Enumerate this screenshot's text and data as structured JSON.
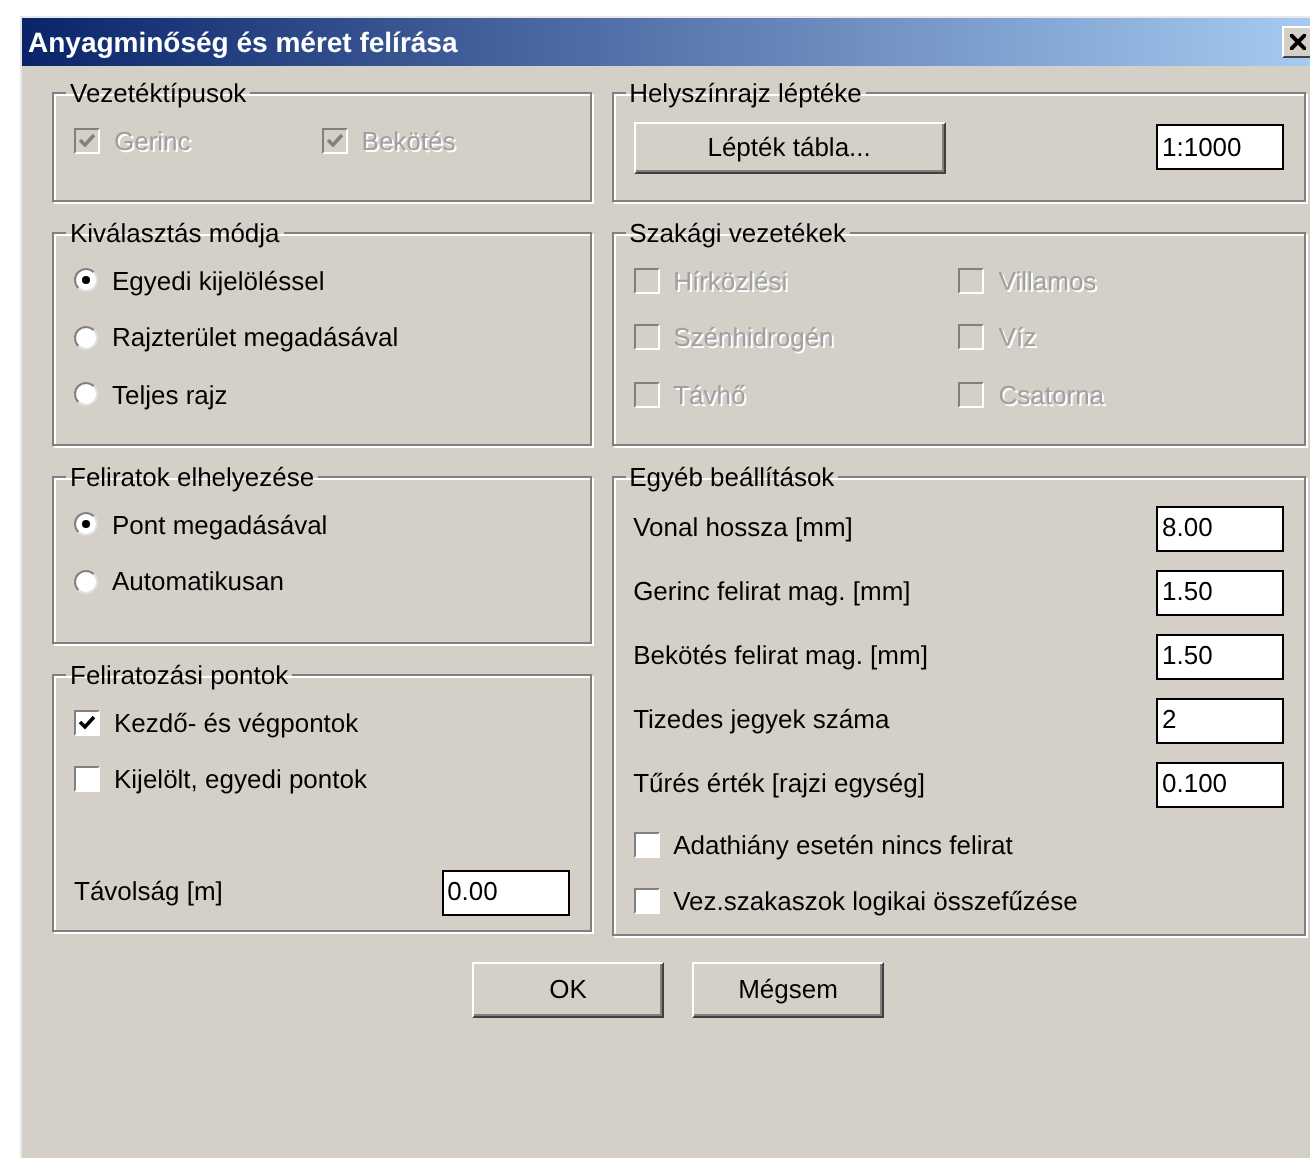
{
  "window": {
    "title": "Anyagminőség és méret felírása"
  },
  "left_column": [
    {
      "title": "Vezetéktípusok",
      "rows": [
        [
          {
            "kind": "checkbox",
            "label": "Gerinc",
            "checked": true,
            "disabled": true
          },
          {
            "kind": "checkbox",
            "label": "Bekötés",
            "checked": true,
            "disabled": true
          }
        ]
      ]
    },
    {
      "title": "Kiválasztás módja",
      "rows": [
        [
          {
            "kind": "radio",
            "label": "Egyedi kijelöléssel",
            "selected": true
          }
        ],
        [
          {
            "kind": "radio",
            "label": "Rajzterület megadásával",
            "selected": false
          }
        ],
        [
          {
            "kind": "radio",
            "label": "Teljes rajz",
            "selected": false
          }
        ]
      ]
    },
    {
      "title": "Feliratok elhelyezése",
      "rows": [
        [
          {
            "kind": "radio",
            "label": "Pont megadásával",
            "selected": true
          }
        ],
        [
          {
            "kind": "radio",
            "label": "Automatikusan",
            "selected": false
          }
        ]
      ]
    },
    {
      "title": "Feliratozási pontok",
      "rows": [
        [
          {
            "kind": "checkbox",
            "label": "Kezdő- és végpontok",
            "checked": true,
            "disabled": false
          }
        ],
        [
          {
            "kind": "checkbox",
            "label": "Kijelölt, egyedi pontok",
            "checked": false,
            "disabled": false
          }
        ],
        [
          {
            "kind": "field",
            "label": "Távolság [m]",
            "value": "0.00"
          }
        ]
      ]
    }
  ],
  "right_column": [
    {
      "title": "Helyszínrajz léptéke",
      "rows": [
        [
          {
            "kind": "button",
            "label": "Lépték tábla..."
          },
          {
            "kind": "field",
            "value": "1:1000"
          }
        ]
      ]
    },
    {
      "title": "Szakági vezetékek",
      "rows": [
        [
          {
            "kind": "checkbox",
            "label": "Hírközlési",
            "checked": false,
            "disabled": true
          },
          {
            "kind": "checkbox",
            "label": "Villamos",
            "checked": false,
            "disabled": true
          }
        ],
        [
          {
            "kind": "checkbox",
            "label": "Szénhidrogén",
            "checked": false,
            "disabled": true
          },
          {
            "kind": "checkbox",
            "label": "Víz",
            "checked": false,
            "disabled": true
          }
        ],
        [
          {
            "kind": "checkbox",
            "label": "Távhő",
            "checked": false,
            "disabled": true
          },
          {
            "kind": "checkbox",
            "label": "Csatorna",
            "checked": false,
            "disabled": true
          }
        ]
      ]
    },
    {
      "title": "Egyéb beállítások",
      "rows": [
        [
          {
            "kind": "field",
            "label": "Vonal hossza [mm]",
            "value": "8.00"
          }
        ],
        [
          {
            "kind": "field",
            "label": "Gerinc felirat mag. [mm]",
            "value": "1.50"
          }
        ],
        [
          {
            "kind": "field",
            "label": "Bekötés felirat mag. [mm]",
            "value": "1.50"
          }
        ],
        [
          {
            "kind": "field",
            "label": "Tizedes jegyek száma",
            "value": "2"
          }
        ],
        [
          {
            "kind": "field",
            "label": "Tűrés érték [rajzi egység]",
            "value": "0.100"
          }
        ],
        [
          {
            "kind": "checkbox",
            "label": "Adathiány esetén nincs felirat",
            "checked": false,
            "disabled": false
          }
        ],
        [
          {
            "kind": "checkbox",
            "label": "Vez.szakaszok logikai összefűzése",
            "checked": false,
            "disabled": false
          }
        ]
      ]
    }
  ],
  "buttons": [
    {
      "label": "OK"
    },
    {
      "label": "Mégsem"
    }
  ]
}
